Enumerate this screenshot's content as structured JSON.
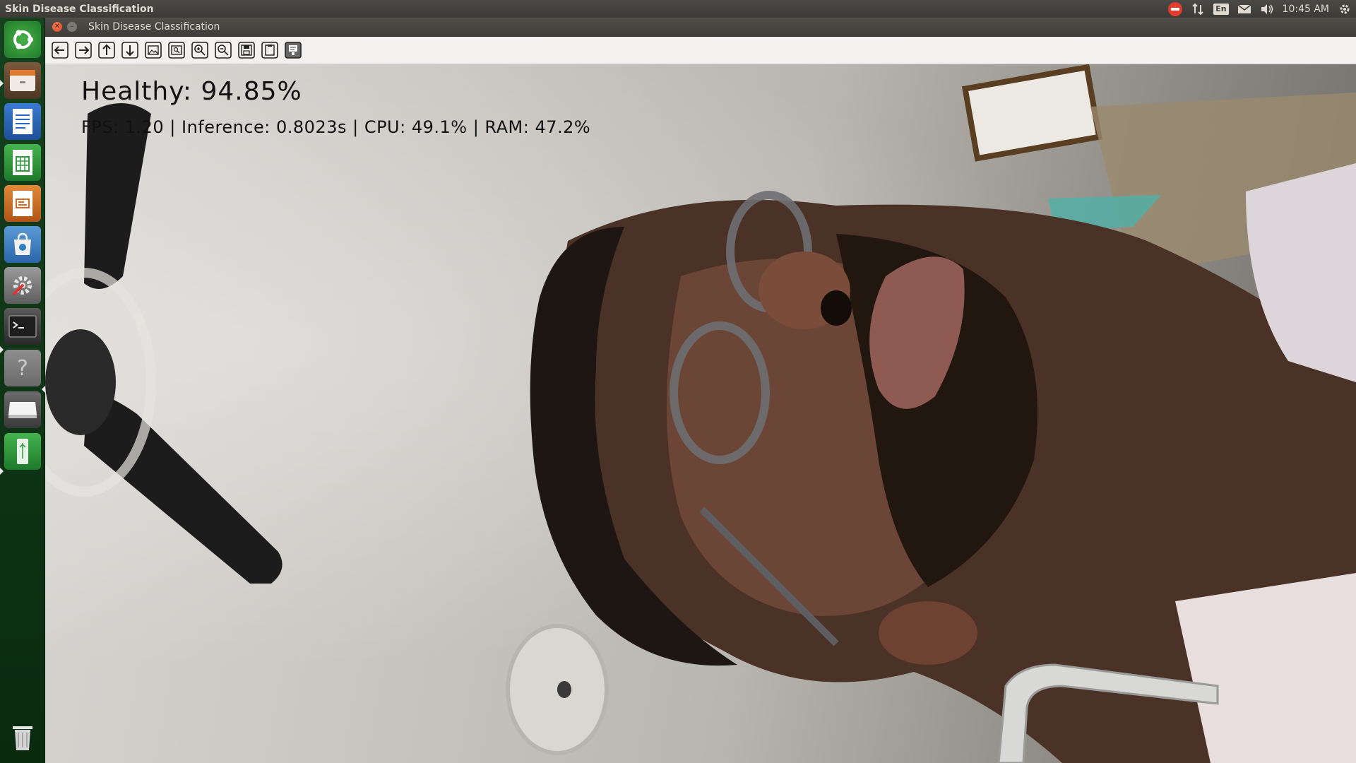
{
  "top_panel": {
    "app_title": "Skin Disease Classification",
    "keyboard_layout": "En",
    "clock": "10:45 AM",
    "icons": [
      "no-entry-icon",
      "network-arrows-icon",
      "keyboard-layout-icon",
      "mail-icon",
      "volume-icon",
      "gear-icon"
    ]
  },
  "launcher": {
    "items": [
      {
        "name": "ubuntu-dash-icon",
        "color": "#2f8a3a"
      },
      {
        "name": "file-manager-icon",
        "color": "#c8732a"
      },
      {
        "name": "writer-icon",
        "color": "#2a68c8"
      },
      {
        "name": "calc-icon",
        "color": "#2f9a3a"
      },
      {
        "name": "impress-icon",
        "color": "#d46a1f"
      },
      {
        "name": "software-center-icon",
        "color": "#2c7fc0"
      },
      {
        "name": "system-settings-icon",
        "color": "#8a8a8a"
      },
      {
        "name": "terminal-icon",
        "color": "#2b2b2b"
      },
      {
        "name": "help-icon",
        "color": "#9a9a9a"
      },
      {
        "name": "disk-drive-icon",
        "color": "#bdbdbd"
      },
      {
        "name": "usb-drive-icon",
        "color": "#2f9a3a"
      },
      {
        "name": "trash-icon",
        "color": "#cfcfcf"
      }
    ]
  },
  "window": {
    "title": "Skin Disease Classification",
    "toolbar_buttons": [
      "arrow-left-icon",
      "arrow-right-icon",
      "arrow-up-icon",
      "arrow-down-icon",
      "image-icon",
      "image-zoom-icon",
      "zoom-in-icon",
      "zoom-out-icon",
      "save-icon",
      "copy-icon",
      "properties-icon"
    ]
  },
  "overlay": {
    "prediction": "Healthy:  94.85%",
    "stats": "FPS:  1.20  |  Inference:  0.8023s  |  CPU:  49.1%  |  RAM:  47.2%"
  },
  "colors": {
    "launcher_bg": "#0f3416",
    "panel_bg": "#3c3b37",
    "toolbar_bg": "#f2f1f0",
    "overlay_text": "#111111"
  }
}
